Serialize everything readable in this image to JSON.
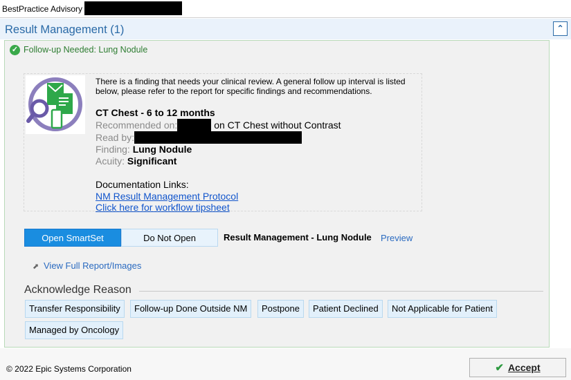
{
  "window": {
    "title": "BestPractice Advisory -"
  },
  "header": {
    "title": "Result Management (1)"
  },
  "alert": {
    "title": "Follow-up Needed: Lung Nodule",
    "intro": "There is a finding that needs your clinical review.  A general follow up interval is listed below, please refer to the report for specific findings and recommendations.",
    "recommendation": "CT Chest - 6 to 12 months",
    "recommended_on_label": "Recommended on:",
    "recommended_on_suffix": "on CT Chest without Contrast",
    "read_by_label": "Read by:",
    "finding_label": "Finding:",
    "finding_value": "Lung Nodule",
    "acuity_label": "Acuity:",
    "acuity_value": "Significant",
    "doc_links_label": "Documentation Links:",
    "doc_links": [
      "NM Result Management Protocol",
      "Click here for workflow tipsheet"
    ]
  },
  "actions": {
    "open_smartset": "Open SmartSet",
    "do_not_open": "Do Not Open",
    "smartset_name": "Result Management - Lung Nodule",
    "preview": "Preview",
    "view_report": "View Full Report/Images"
  },
  "acknowledge": {
    "heading": "Acknowledge Reason",
    "reasons": [
      "Transfer Responsibility",
      "Follow-up Done Outside NM",
      "Postpone",
      "Patient Declined",
      "Not Applicable for Patient",
      "Managed by Oncology"
    ]
  },
  "footer": {
    "copyright": "© 2022 Epic Systems Corporation",
    "accept": "Accept"
  },
  "icons": [
    "check-circle-icon",
    "collapse-up-icon",
    "result-review-logo-icon",
    "external-link-icon",
    "checkmark-icon"
  ],
  "colors": {
    "accent": "#1a8de0",
    "header_text": "#2a6aa7",
    "success": "#3aa94a",
    "link": "#1155cc"
  }
}
